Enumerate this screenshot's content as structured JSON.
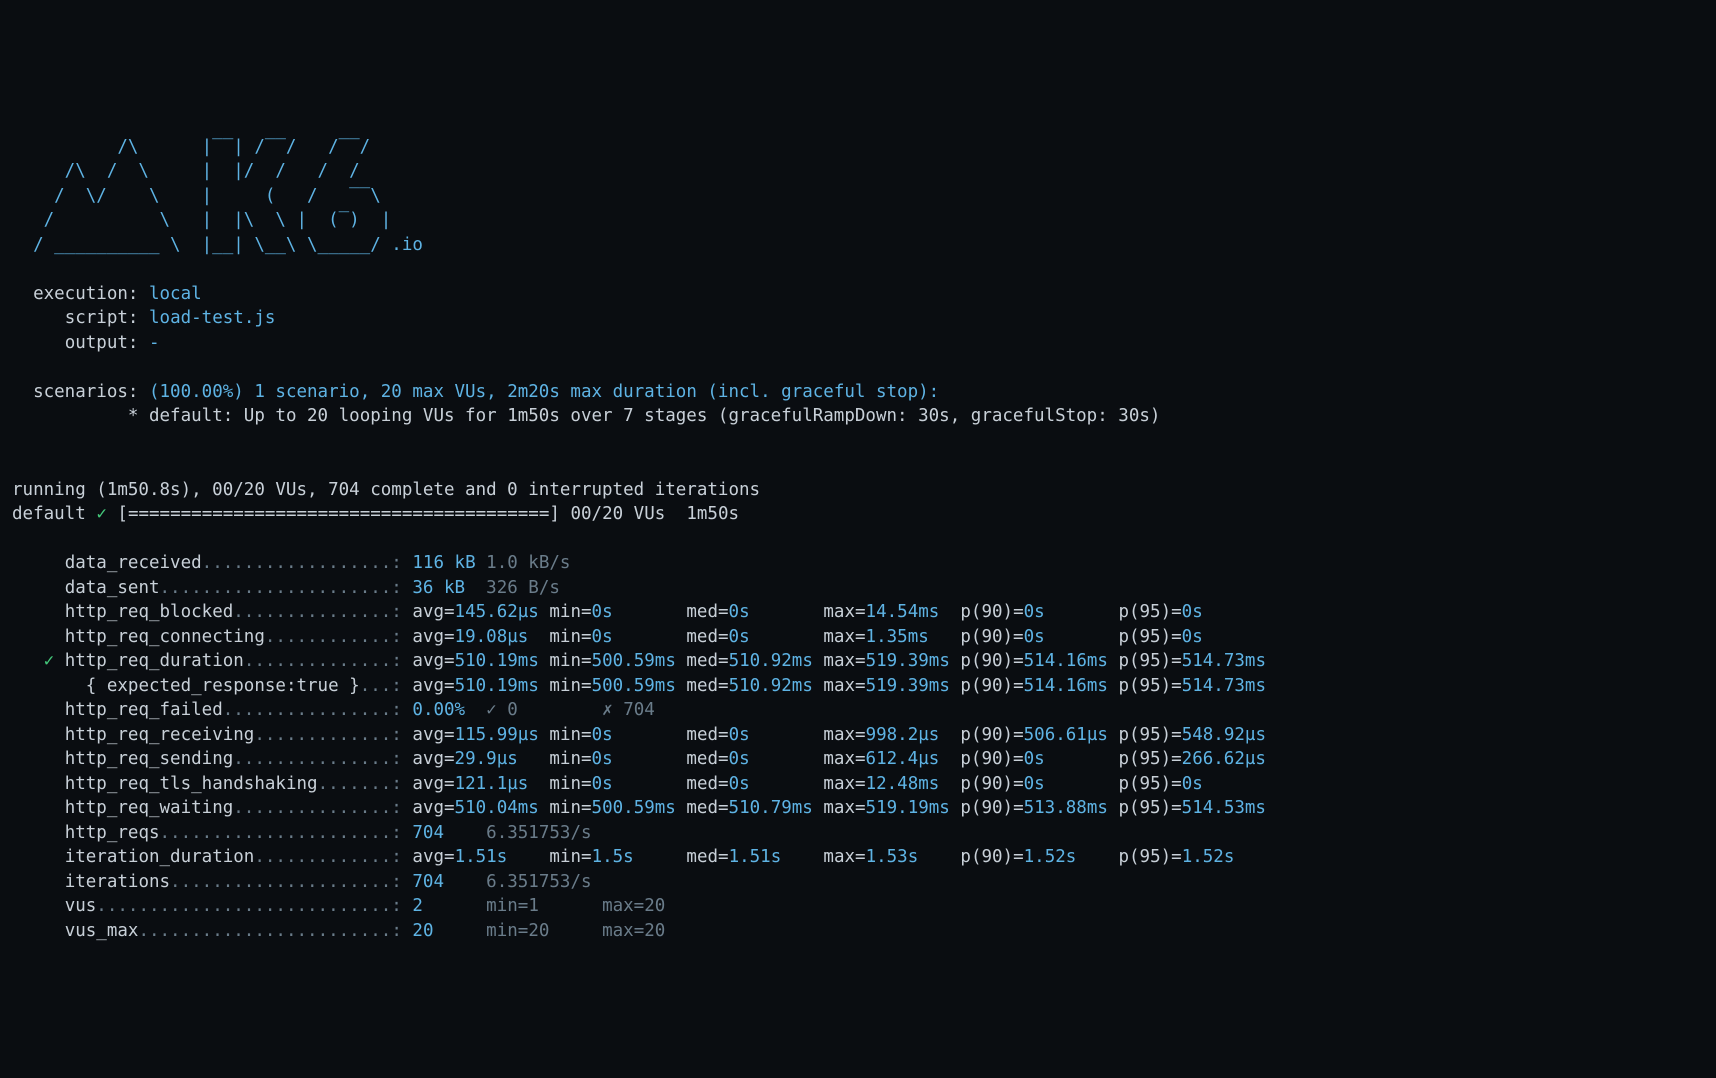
{
  "logo": {
    "io": ".io"
  },
  "exec": {
    "label_execution": "execution:",
    "value_execution": "local",
    "label_script": "script:",
    "value_script": "load-test.js",
    "label_output": "output:",
    "value_output": "-",
    "label_scenarios": "scenarios:",
    "scenarios_summary": "(100.00%) 1 scenario, 20 max VUs, 2m20s max duration (incl. graceful stop):",
    "default_line": "* default: Up to 20 looping VUs for 1m50s over 7 stages (gracefulRampDown: 30s, gracefulStop: 30s)"
  },
  "progress": {
    "running": "running (1m50.8s), 00/20 VUs, 704 complete and 0 interrupted iterations",
    "default_label": "default",
    "check": "✓",
    "bar": "[========================================]",
    "status": "00/20 VUs  1m50s"
  },
  "metrics": {
    "data_received": {
      "name": "data_received",
      "dots": "..................:",
      "v1": "116 kB",
      "v2": "1.0 kB/s"
    },
    "data_sent": {
      "name": "data_sent",
      "dots": "......................:",
      "v1": "36 kB",
      "v2": "326 B/s"
    },
    "http_req_blocked": {
      "name": "http_req_blocked",
      "dots": "...............:",
      "avg": "145.62µs",
      "min": "0s",
      "med": "0s",
      "max": "14.54ms",
      "p90": "0s",
      "p95": "0s"
    },
    "http_req_connecting": {
      "name": "http_req_connecting",
      "dots": "............:",
      "avg": "19.08µs",
      "min": "0s",
      "med": "0s",
      "max": "1.35ms",
      "p90": "0s",
      "p95": "0s"
    },
    "http_req_duration": {
      "name": "http_req_duration",
      "dots": "..............:",
      "avg": "510.19ms",
      "min": "500.59ms",
      "med": "510.92ms",
      "max": "519.39ms",
      "p90": "514.16ms",
      "p95": "514.73ms"
    },
    "expected_response": {
      "name": "{ expected_response:true }",
      "dots": "...:",
      "avg": "510.19ms",
      "min": "500.59ms",
      "med": "510.92ms",
      "max": "519.39ms",
      "p90": "514.16ms",
      "p95": "514.73ms"
    },
    "http_req_failed": {
      "name": "http_req_failed",
      "dots": "................:",
      "pct": "0.00%",
      "pass_mark": "✓",
      "pass": "0",
      "fail_mark": "✗",
      "fail": "704"
    },
    "http_req_receiving": {
      "name": "http_req_receiving",
      "dots": ".............:",
      "avg": "115.99µs",
      "min": "0s",
      "med": "0s",
      "max": "998.2µs",
      "p90": "506.61µs",
      "p95": "548.92µs"
    },
    "http_req_sending": {
      "name": "http_req_sending",
      "dots": "...............:",
      "avg": "29.9µs",
      "min": "0s",
      "med": "0s",
      "max": "612.4µs",
      "p90": "0s",
      "p95": "266.62µs"
    },
    "http_req_tls_handshaking": {
      "name": "http_req_tls_handshaking",
      "dots": ".......:",
      "avg": "121.1µs",
      "min": "0s",
      "med": "0s",
      "max": "12.48ms",
      "p90": "0s",
      "p95": "0s"
    },
    "http_req_waiting": {
      "name": "http_req_waiting",
      "dots": "...............:",
      "avg": "510.04ms",
      "min": "500.59ms",
      "med": "510.79ms",
      "max": "519.19ms",
      "p90": "513.88ms",
      "p95": "514.53ms"
    },
    "http_reqs": {
      "name": "http_reqs",
      "dots": "......................:",
      "v1": "704",
      "v2": "6.351753/s"
    },
    "iteration_duration": {
      "name": "iteration_duration",
      "dots": ".............:",
      "avg": "1.51s",
      "min": "1.5s",
      "med": "1.51s",
      "max": "1.53s",
      "p90": "1.52s",
      "p95": "1.52s"
    },
    "iterations": {
      "name": "iterations",
      "dots": ".....................:",
      "v1": "704",
      "v2": "6.351753/s"
    },
    "vus": {
      "name": "vus",
      "dots": "............................:",
      "v1": "2",
      "min": "1",
      "max": "20"
    },
    "vus_max": {
      "name": "vus_max",
      "dots": "........................:",
      "v1": "20",
      "min": "20",
      "max": "20"
    }
  }
}
